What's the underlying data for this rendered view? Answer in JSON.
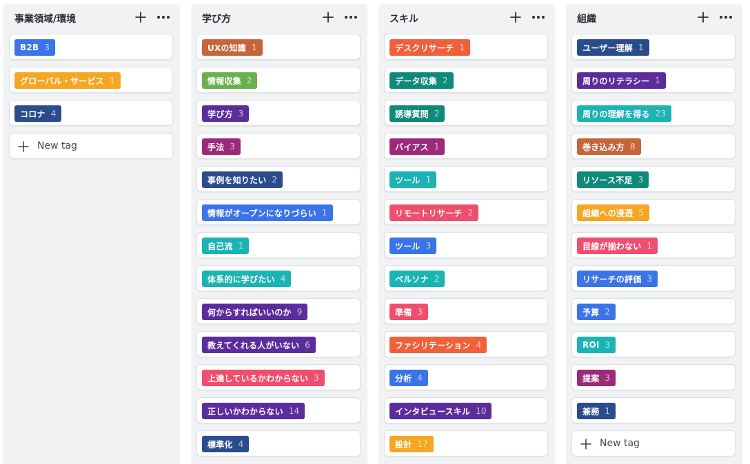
{
  "columns": [
    {
      "title": "事業領域/環境",
      "tags": [
        {
          "label": "B2B",
          "count": "3",
          "color": "#3b73e8"
        },
        {
          "label": "グローバル・サービス",
          "count": "1",
          "color": "#f5a623"
        },
        {
          "label": "コロナ",
          "count": "4",
          "color": "#2b4c8c"
        }
      ],
      "new_tag_label": "New tag"
    },
    {
      "title": "学び方",
      "tags": [
        {
          "label": "UXの知識",
          "count": "1",
          "color": "#c7643a"
        },
        {
          "label": "情報収集",
          "count": "2",
          "color": "#6ab04c"
        },
        {
          "label": "学び方",
          "count": "3",
          "color": "#5b2d9c"
        },
        {
          "label": "手法",
          "count": "3",
          "color": "#9c2a7a"
        },
        {
          "label": "事例を知りたい",
          "count": "2",
          "color": "#2b4c8c"
        },
        {
          "label": "情報がオープンになりづらい",
          "count": "1",
          "color": "#3b73e8"
        },
        {
          "label": "自己流",
          "count": "1",
          "color": "#1bb3b3"
        },
        {
          "label": "体系的に学びたい",
          "count": "4",
          "color": "#1bb3b3"
        },
        {
          "label": "何からすればいいのか",
          "count": "9",
          "color": "#5b2d9c"
        },
        {
          "label": "教えてくれる人がいない",
          "count": "6",
          "color": "#5b2d9c"
        },
        {
          "label": "上達しているかわからない",
          "count": "3",
          "color": "#f04e6e"
        },
        {
          "label": "正しいかわからない",
          "count": "14",
          "color": "#5b2d9c"
        },
        {
          "label": "標準化",
          "count": "4",
          "color": "#2b4c8c"
        }
      ]
    },
    {
      "title": "スキル",
      "tags": [
        {
          "label": "デスクリサーチ",
          "count": "1",
          "color": "#f0603a"
        },
        {
          "label": "データ収集",
          "count": "2",
          "color": "#0f8a7a"
        },
        {
          "label": "誘導質問",
          "count": "2",
          "color": "#0f8a7a"
        },
        {
          "label": "バイアス",
          "count": "1",
          "color": "#9c2a7a"
        },
        {
          "label": "ツール",
          "count": "1",
          "color": "#1bb3b3"
        },
        {
          "label": "リモートリサーチ",
          "count": "2",
          "color": "#f04e6e"
        },
        {
          "label": "ツール",
          "count": "3",
          "color": "#3b73e8"
        },
        {
          "label": "ペルソナ",
          "count": "2",
          "color": "#1bb3b3"
        },
        {
          "label": "準備",
          "count": "3",
          "color": "#f04e6e"
        },
        {
          "label": "ファシリテーション",
          "count": "4",
          "color": "#f0603a"
        },
        {
          "label": "分析",
          "count": "4",
          "color": "#3b73e8"
        },
        {
          "label": "インタビュースキル",
          "count": "10",
          "color": "#5b2d9c"
        },
        {
          "label": "設計",
          "count": "17",
          "color": "#f5a623"
        }
      ]
    },
    {
      "title": "組織",
      "tags": [
        {
          "label": "ユーザー理解",
          "count": "1",
          "color": "#2b4c8c"
        },
        {
          "label": "周りのリテラシー",
          "count": "1",
          "color": "#5b2d9c"
        },
        {
          "label": "周りの理解を得る",
          "count": "23",
          "color": "#1bb3b3"
        },
        {
          "label": "巻き込み方",
          "count": "8",
          "color": "#c7643a"
        },
        {
          "label": "リソース不足",
          "count": "3",
          "color": "#0f8a7a"
        },
        {
          "label": "組織への浸透",
          "count": "5",
          "color": "#f5a623"
        },
        {
          "label": "目線が揃わない",
          "count": "1",
          "color": "#f04e6e"
        },
        {
          "label": "リサーチの評価",
          "count": "3",
          "color": "#3b73e8"
        },
        {
          "label": "予算",
          "count": "2",
          "color": "#3b73e8"
        },
        {
          "label": "ROI",
          "count": "3",
          "color": "#1bb3b3"
        },
        {
          "label": "提案",
          "count": "3",
          "color": "#9c2a7a"
        },
        {
          "label": "兼務",
          "count": "1",
          "color": "#2b4c8c"
        }
      ],
      "new_tag_label": "New tag"
    }
  ]
}
